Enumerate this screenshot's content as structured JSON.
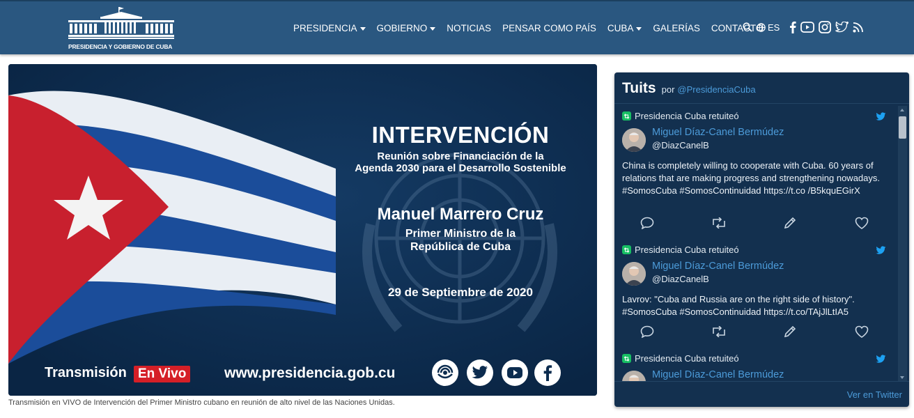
{
  "site": {
    "logo_text": "PRESIDENCIA Y GOBIERNO DE CUBA"
  },
  "nav": {
    "items": [
      {
        "label": "PRESIDENCIA",
        "dropdown": true
      },
      {
        "label": "GOBIERNO",
        "dropdown": true
      },
      {
        "label": "NOTICIAS",
        "dropdown": false
      },
      {
        "label": "PENSAR COMO PAÍS",
        "dropdown": false
      },
      {
        "label": "CUBA",
        "dropdown": true
      },
      {
        "label": "GALERÍAS",
        "dropdown": false
      },
      {
        "label": "CONTACTO",
        "dropdown": false
      }
    ],
    "language": "ES",
    "icons": [
      "search-icon",
      "globe-icon",
      "facebook-icon",
      "youtube-icon",
      "instagram-icon",
      "twitter-icon",
      "rss-icon"
    ]
  },
  "banner": {
    "title": "INTERVENCIÓN",
    "subtitle_line1": "Reunión sobre Financiación de la",
    "subtitle_line2": "Agenda 2030 para el Desarrollo Sostenible",
    "name": "Manuel Marrero Cruz",
    "role_line1": "Primer Ministro de la",
    "role_line2": "República de Cuba",
    "date": "29 de Septiembre de 2020",
    "transmission": "Transmisión",
    "live": "En Vivo",
    "url": "www.presidencia.gob.cu",
    "colors": {
      "background": "#0c2c4f",
      "live_red": "#d51f27"
    }
  },
  "caption": "Transmisión en VIVO de Intervención del Primer Ministro cubano en reunión de alto nivel de las Naciones Unidas.",
  "twitter": {
    "title": "Tuits",
    "by": "por",
    "handle": "@PresidenciaCuba",
    "footer": "Ver en Twitter",
    "tweets": [
      {
        "retweet_label": "Presidencia Cuba retuiteó",
        "author": "Miguel Díaz-Canel Bermúdez",
        "username": "@DiazCanelB",
        "text": "China is completely willing to cooperate with Cuba. 60 years of relations that are making progress and strengthening nowadays. #SomosCuba #SomosContinuidad https://t.co /B5kquEGirX"
      },
      {
        "retweet_label": "Presidencia Cuba retuiteó",
        "author": "Miguel Díaz-Canel Bermúdez",
        "username": "@DiazCanelB",
        "text": "Lavrov: \"Cuba and Russia are on the right side of history\". #SomosCuba #SomosContinuidad https://t.co/TAjJlLtIA5"
      },
      {
        "retweet_label": "Presidencia Cuba retuiteó",
        "author": "Miguel Díaz-Canel Bermúdez"
      }
    ],
    "colors": {
      "panel": "#13304f",
      "link": "#4c9bd9",
      "retweet_green": "#17bf63"
    }
  }
}
